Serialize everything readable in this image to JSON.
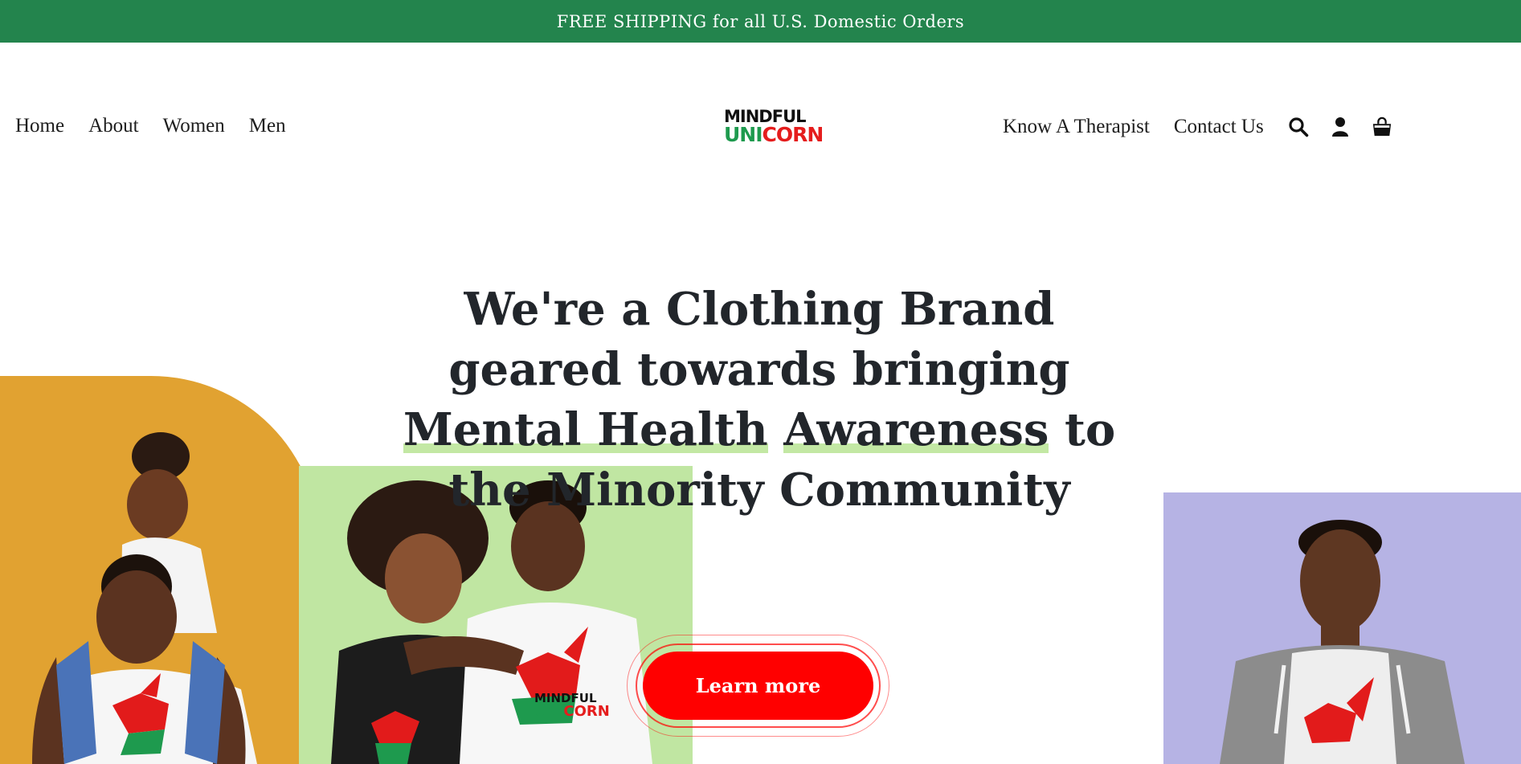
{
  "announcement": {
    "text": "FREE SHIPPING for all U.S. Domestic Orders",
    "bg_color": "#23844d"
  },
  "nav_left": [
    {
      "label": "Home"
    },
    {
      "label": "About"
    },
    {
      "label": "Women"
    },
    {
      "label": "Men"
    }
  ],
  "logo": {
    "line1": "MINDFUL",
    "line2_green": "UNI",
    "line2_red": "CORN"
  },
  "nav_right": [
    {
      "label": "Know A Therapist"
    },
    {
      "label": "Contact Us"
    }
  ],
  "header_icons": [
    "search-icon",
    "account-icon",
    "cart-icon"
  ],
  "hero": {
    "title_part1": "We're a Clothing Brand geared towards bringing ",
    "title_highlight1": "Mental Health",
    "title_space": " ",
    "title_highlight2": "Awareness",
    "title_part2": " to the Minority Community",
    "highlight_color": "#c3e8a4",
    "cta_label": "Learn more",
    "cta_color": "#ff0000"
  },
  "photos": [
    {
      "name": "family-photo",
      "bg_color": "#e1a231"
    },
    {
      "name": "couple-photo",
      "bg_color": "#c0e6a2"
    },
    {
      "name": "man-hoodie-photo",
      "bg_color": "#b6b3e4"
    }
  ],
  "shirt_logo": {
    "line1": "MINDFUL",
    "line2_green": "UNI",
    "line2_red": "CORN"
  }
}
